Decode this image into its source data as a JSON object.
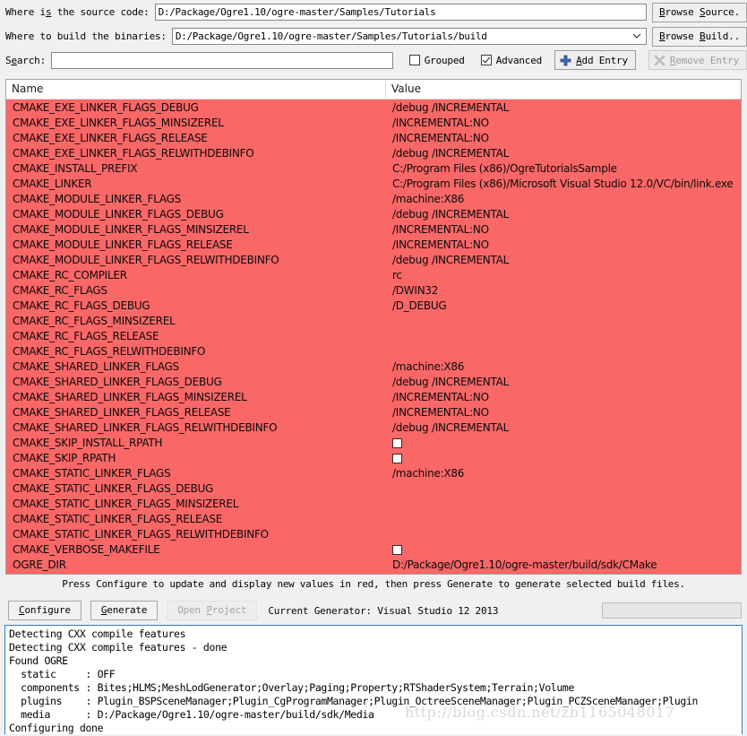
{
  "source_row": {
    "label_pre": "Where is the source code:",
    "label_acc": "s",
    "value": "D:/Package/Ogre1.10/ogre-master/Samples/Tutorials",
    "browse_button": "Browse Source.",
    "browse_acc": "S"
  },
  "build_row": {
    "label": "Where to build the binaries:",
    "value": "D:/Package/Ogre1.10/ogre-master/Samples/Tutorials/build",
    "browse_button": "Browse Build..",
    "browse_acc": "B"
  },
  "search_row": {
    "label": "Search:",
    "value": "",
    "placeholder": "",
    "grouped_label": "Grouped",
    "grouped_checked": false,
    "advanced_label": "Advanced",
    "advanced_checked": true,
    "add_entry_label": "Add Entry",
    "add_entry_icon": "plus-icon",
    "remove_entry_label": "Remove Entry",
    "remove_entry_icon": "x-icon",
    "remove_entry_disabled": true
  },
  "table": {
    "columns": [
      "Name",
      "Value"
    ],
    "rows": [
      {
        "name": "CMAKE_EXE_LINKER_FLAGS_DEBUG",
        "value": "/debug /INCREMENTAL",
        "type": "text"
      },
      {
        "name": "CMAKE_EXE_LINKER_FLAGS_MINSIZEREL",
        "value": "/INCREMENTAL:NO",
        "type": "text"
      },
      {
        "name": "CMAKE_EXE_LINKER_FLAGS_RELEASE",
        "value": "/INCREMENTAL:NO",
        "type": "text"
      },
      {
        "name": "CMAKE_EXE_LINKER_FLAGS_RELWITHDEBINFO",
        "value": "/debug /INCREMENTAL",
        "type": "text"
      },
      {
        "name": "CMAKE_INSTALL_PREFIX",
        "value": "C:/Program Files (x86)/OgreTutorialsSample",
        "type": "text"
      },
      {
        "name": "CMAKE_LINKER",
        "value": "C:/Program Files (x86)/Microsoft Visual Studio 12.0/VC/bin/link.exe",
        "type": "text"
      },
      {
        "name": "CMAKE_MODULE_LINKER_FLAGS",
        "value": "/machine:X86",
        "type": "text"
      },
      {
        "name": "CMAKE_MODULE_LINKER_FLAGS_DEBUG",
        "value": "/debug /INCREMENTAL",
        "type": "text"
      },
      {
        "name": "CMAKE_MODULE_LINKER_FLAGS_MINSIZEREL",
        "value": "/INCREMENTAL:NO",
        "type": "text"
      },
      {
        "name": "CMAKE_MODULE_LINKER_FLAGS_RELEASE",
        "value": "/INCREMENTAL:NO",
        "type": "text"
      },
      {
        "name": "CMAKE_MODULE_LINKER_FLAGS_RELWITHDEBINFO",
        "value": "/debug /INCREMENTAL",
        "type": "text"
      },
      {
        "name": "CMAKE_RC_COMPILER",
        "value": "rc",
        "type": "text"
      },
      {
        "name": "CMAKE_RC_FLAGS",
        "value": "/DWIN32",
        "type": "text"
      },
      {
        "name": "CMAKE_RC_FLAGS_DEBUG",
        "value": "/D_DEBUG",
        "type": "text"
      },
      {
        "name": "CMAKE_RC_FLAGS_MINSIZEREL",
        "value": "",
        "type": "text"
      },
      {
        "name": "CMAKE_RC_FLAGS_RELEASE",
        "value": "",
        "type": "text"
      },
      {
        "name": "CMAKE_RC_FLAGS_RELWITHDEBINFO",
        "value": "",
        "type": "text"
      },
      {
        "name": "CMAKE_SHARED_LINKER_FLAGS",
        "value": "/machine:X86",
        "type": "text"
      },
      {
        "name": "CMAKE_SHARED_LINKER_FLAGS_DEBUG",
        "value": "/debug /INCREMENTAL",
        "type": "text"
      },
      {
        "name": "CMAKE_SHARED_LINKER_FLAGS_MINSIZEREL",
        "value": "/INCREMENTAL:NO",
        "type": "text"
      },
      {
        "name": "CMAKE_SHARED_LINKER_FLAGS_RELEASE",
        "value": "/INCREMENTAL:NO",
        "type": "text"
      },
      {
        "name": "CMAKE_SHARED_LINKER_FLAGS_RELWITHDEBINFO",
        "value": "/debug /INCREMENTAL",
        "type": "text"
      },
      {
        "name": "CMAKE_SKIP_INSTALL_RPATH",
        "value": "",
        "type": "checkbox",
        "checked": false
      },
      {
        "name": "CMAKE_SKIP_RPATH",
        "value": "",
        "type": "checkbox",
        "checked": false
      },
      {
        "name": "CMAKE_STATIC_LINKER_FLAGS",
        "value": "/machine:X86",
        "type": "text"
      },
      {
        "name": "CMAKE_STATIC_LINKER_FLAGS_DEBUG",
        "value": "",
        "type": "text"
      },
      {
        "name": "CMAKE_STATIC_LINKER_FLAGS_MINSIZEREL",
        "value": "",
        "type": "text"
      },
      {
        "name": "CMAKE_STATIC_LINKER_FLAGS_RELEASE",
        "value": "",
        "type": "text"
      },
      {
        "name": "CMAKE_STATIC_LINKER_FLAGS_RELWITHDEBINFO",
        "value": "",
        "type": "text"
      },
      {
        "name": "CMAKE_VERBOSE_MAKEFILE",
        "value": "",
        "type": "checkbox",
        "checked": false
      },
      {
        "name": "OGRE_DIR",
        "value": "D:/Package/Ogre1.10/ogre-master/build/sdk/CMake",
        "type": "text"
      }
    ],
    "highlight_color": "#fa6767"
  },
  "hint": "Press Configure to update and display new values in red, then press Generate to generate selected build files.",
  "actions": {
    "configure_label": "Configure",
    "configure_acc": "C",
    "generate_label": "Generate",
    "generate_acc": "G",
    "open_project_label": "Open Project",
    "open_project_acc": "P",
    "open_project_disabled": true,
    "current_generator": "Current Generator: Visual Studio 12 2013"
  },
  "log": {
    "lines": [
      "Detecting CXX compile features",
      "Detecting CXX compile features - done",
      "Found OGRE",
      "  static     : OFF",
      "  components : Bites;HLMS;MeshLodGenerator;Overlay;Paging;Property;RTShaderSystem;Terrain;Volume",
      "  plugins    : Plugin_BSPSceneManager;Plugin_CgProgramManager;Plugin_OctreeSceneManager;Plugin_PCZSceneManager;Plugin",
      "  media      : D:/Package/Ogre1.10/ogre-master/build/sdk/Media",
      "Configuring done"
    ]
  },
  "watermark": "http://blog.csdn.net/zb1165048017"
}
